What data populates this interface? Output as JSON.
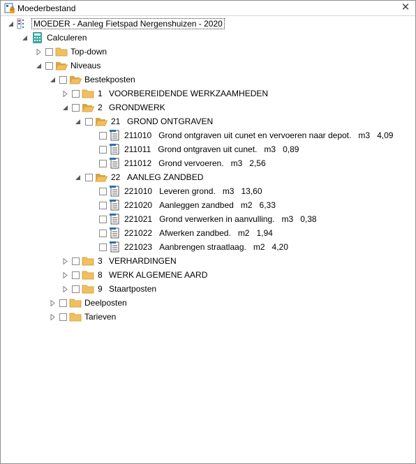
{
  "window": {
    "title": "Moederbestand",
    "close_glyph": "✕",
    "close_icon": "close-icon"
  },
  "tree": {
    "root": {
      "label": "MOEDER - Aanleg Fietspad Nergenshuizen - 2020"
    },
    "calculeren": {
      "label": "Calculeren"
    },
    "topdown": {
      "label": "Top-down"
    },
    "niveaus": {
      "label": "Niveaus"
    },
    "bestekposten": {
      "label": "Bestekposten"
    },
    "n1": {
      "code": "1",
      "label": "VOORBEREIDENDE WERKZAAMHEDEN"
    },
    "n2": {
      "code": "2",
      "label": "GRONDWERK"
    },
    "n21": {
      "code": "21",
      "label": "GROND ONTGRAVEN"
    },
    "i211010": {
      "code": "211010",
      "label": "Grond ontgraven uit cunet en vervoeren naar depot.",
      "unit": "m3",
      "value": "4,09"
    },
    "i211011": {
      "code": "211011",
      "label": "Grond ontgraven uit cunet.",
      "unit": "m3",
      "value": "0,89"
    },
    "i211012": {
      "code": "211012",
      "label": "Grond vervoeren.",
      "unit": "m3",
      "value": "2,56"
    },
    "n22": {
      "code": "22",
      "label": "AANLEG ZANDBED"
    },
    "i221010": {
      "code": "221010",
      "label": "Leveren grond.",
      "unit": "m3",
      "value": "13,60"
    },
    "i221020": {
      "code": "221020",
      "label": "Aanleggen zandbed",
      "unit": "m2",
      "value": "6,33"
    },
    "i221021": {
      "code": "221021",
      "label": "Grond verwerken in aanvulling.",
      "unit": "m3",
      "value": "0,38"
    },
    "i221022": {
      "code": "221022",
      "label": "Afwerken zandbed.",
      "unit": "m2",
      "value": "1,94"
    },
    "i221023": {
      "code": "221023",
      "label": "Aanbrengen straatlaag.",
      "unit": "m2",
      "value": "4,20"
    },
    "n3": {
      "code": "3",
      "label": "VERHARDINGEN"
    },
    "n8": {
      "code": "8",
      "label": "WERK ALGEMENE AARD"
    },
    "n9": {
      "code": "9",
      "label": "Staartposten"
    },
    "deelposten": {
      "label": "Deelposten"
    },
    "tarieven": {
      "label": "Tarieven"
    }
  },
  "colors": {
    "folder": "#f0c060",
    "folder_dark": "#d9a441",
    "calc_icon": "#3aa6a0",
    "doc_accent": "#2d6fb5",
    "arrow": "#808080"
  }
}
